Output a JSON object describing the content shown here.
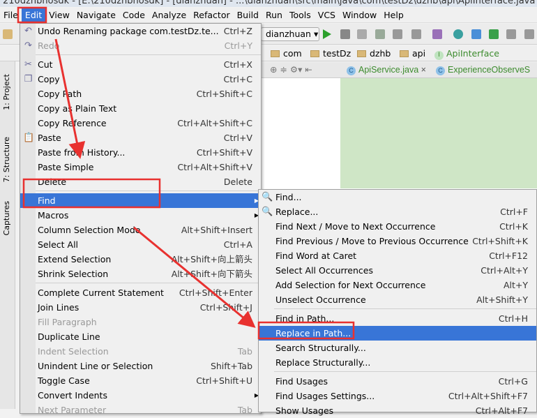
{
  "window_title": "210dzhbhosdk - [E:\\210dzhbhosdk] - [dianzhuan] - ...\\dianzhuan\\src\\main\\java\\com\\testDz\\dzhb\\api\\ApiInterface.java - Android Studio",
  "menubar": [
    "File",
    "Edit",
    "View",
    "Navigate",
    "Code",
    "Analyze",
    "Refactor",
    "Build",
    "Run",
    "Tools",
    "VCS",
    "Window",
    "Help"
  ],
  "toolbar": {
    "run_config": "dianzhuan"
  },
  "breadcrumbs": [
    "com",
    "testDz",
    "dzhb",
    "api",
    "ApiInterface"
  ],
  "tabs": [
    "ApiService.java",
    "ExperienceObserveS"
  ],
  "left_strip": [
    "1: Project",
    "7: Structure",
    "Captures"
  ],
  "edit_menu": {
    "groups": [
      [
        {
          "label": "Undo Renaming package com.testDz.te...",
          "shortcut": "Ctrl+Z",
          "icon": "undo-icon"
        },
        {
          "label": "Redo",
          "shortcut": "Ctrl+Y",
          "disabled": true,
          "icon": "redo-icon"
        }
      ],
      [
        {
          "label": "Cut",
          "shortcut": "Ctrl+X",
          "icon": "cut-icon"
        },
        {
          "label": "Copy",
          "shortcut": "Ctrl+C",
          "icon": "copy-icon"
        },
        {
          "label": "Copy Path",
          "shortcut": "Ctrl+Shift+C"
        },
        {
          "label": "Copy as Plain Text",
          "shortcut": ""
        },
        {
          "label": "Copy Reference",
          "shortcut": "Ctrl+Alt+Shift+C"
        },
        {
          "label": "Paste",
          "shortcut": "Ctrl+V",
          "icon": "paste-icon"
        },
        {
          "label": "Paste from History...",
          "shortcut": "Ctrl+Shift+V"
        },
        {
          "label": "Paste Simple",
          "shortcut": "Ctrl+Alt+Shift+V"
        },
        {
          "label": "Delete",
          "shortcut": "Delete"
        }
      ],
      [
        {
          "label": "Find",
          "shortcut": "",
          "submenu": true,
          "selected": true
        },
        {
          "label": "Macros",
          "shortcut": "",
          "submenu": true
        },
        {
          "label": "Column Selection Mode",
          "shortcut": "Alt+Shift+Insert"
        },
        {
          "label": "Select All",
          "shortcut": "Ctrl+A"
        },
        {
          "label": "Extend Selection",
          "shortcut": "Alt+Shift+向上箭头"
        },
        {
          "label": "Shrink Selection",
          "shortcut": "Alt+Shift+向下箭头"
        }
      ],
      [
        {
          "label": "Complete Current Statement",
          "shortcut": "Ctrl+Shift+Enter"
        },
        {
          "label": "Join Lines",
          "shortcut": "Ctrl+Shift+J"
        },
        {
          "label": "Fill Paragraph",
          "shortcut": "",
          "disabled": true
        },
        {
          "label": "Duplicate Line",
          "shortcut": ""
        },
        {
          "label": "Indent Selection",
          "shortcut": "Tab",
          "disabled": true
        },
        {
          "label": "Unindent Line or Selection",
          "shortcut": "Shift+Tab"
        },
        {
          "label": "Toggle Case",
          "shortcut": "Ctrl+Shift+U"
        },
        {
          "label": "Convert Indents",
          "shortcut": "",
          "submenu": true
        },
        {
          "label": "Next Parameter",
          "shortcut": "Tab",
          "disabled": true
        }
      ]
    ]
  },
  "find_menu": {
    "groups": [
      [
        {
          "label": "Find...",
          "shortcut": "",
          "icon": "search-icon"
        },
        {
          "label": "Replace...",
          "shortcut": "Ctrl+F",
          "icon": "replace-icon"
        },
        {
          "label": "Find Next / Move to Next Occurrence",
          "shortcut": "Ctrl+K"
        },
        {
          "label": "Find Previous / Move to Previous Occurrence",
          "shortcut": "Ctrl+Shift+K"
        },
        {
          "label": "Find Word at Caret",
          "shortcut": "Ctrl+F12"
        },
        {
          "label": "Select All Occurrences",
          "shortcut": "Ctrl+Alt+Y"
        },
        {
          "label": "Add Selection for Next Occurrence",
          "shortcut": "Alt+Y"
        },
        {
          "label": "Unselect Occurrence",
          "shortcut": "Alt+Shift+Y"
        }
      ],
      [
        {
          "label": "Find in Path...",
          "shortcut": "Ctrl+H"
        },
        {
          "label": "Replace in Path...",
          "shortcut": "",
          "selected": true
        },
        {
          "label": "Search Structurally...",
          "shortcut": ""
        },
        {
          "label": "Replace Structurally...",
          "shortcut": ""
        }
      ],
      [
        {
          "label": "Find Usages",
          "shortcut": "Ctrl+G"
        },
        {
          "label": "Find Usages Settings...",
          "shortcut": "Ctrl+Alt+Shift+F7"
        },
        {
          "label": "Show Usages",
          "shortcut": "Ctrl+Alt+F7"
        }
      ]
    ]
  },
  "colors": {
    "selection": "#3875d7",
    "annotation": "#e8312f"
  }
}
